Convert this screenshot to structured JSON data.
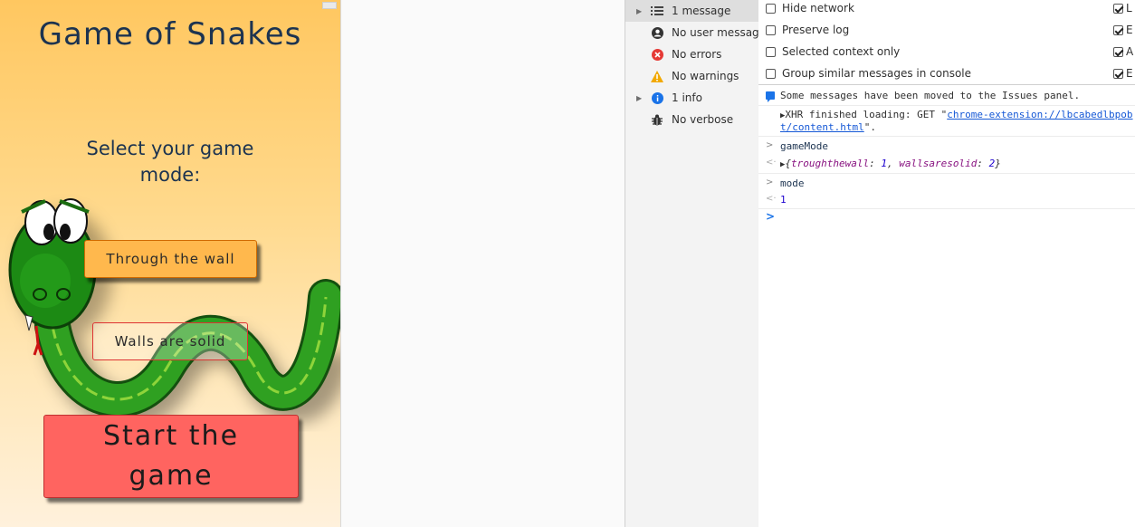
{
  "game": {
    "title": "Game of Snakes",
    "subtitle": "Select your game mode:",
    "buttons": {
      "through_wall": "Through the wall",
      "walls_solid": "Walls are solid",
      "start": "Start the game"
    },
    "colors": {
      "background": "#ffc760",
      "through_button": "#ffb84d",
      "start_button": "#ff6460"
    }
  },
  "devtools": {
    "sidebar": {
      "items": [
        {
          "icon": "list-icon",
          "label": "1 message",
          "expandable": true,
          "selected": true
        },
        {
          "icon": "user-icon",
          "label": "No user messag…",
          "expandable": false
        },
        {
          "icon": "error-icon",
          "label": "No errors",
          "expandable": false
        },
        {
          "icon": "warning-icon",
          "label": "No warnings",
          "expandable": false
        },
        {
          "icon": "info-icon",
          "label": "1 info",
          "expandable": true
        },
        {
          "icon": "bug-icon",
          "label": "No verbose",
          "expandable": false
        }
      ]
    },
    "settings": {
      "left": [
        {
          "label": "Hide network",
          "checked": false
        },
        {
          "label": "Preserve log",
          "checked": false
        },
        {
          "label": "Selected context only",
          "checked": false
        },
        {
          "label": "Group similar messages in console",
          "checked": false
        }
      ],
      "right": [
        {
          "label": "L",
          "checked": true
        },
        {
          "label": "E",
          "checked": true
        },
        {
          "label": "A",
          "checked": true
        },
        {
          "label": "E",
          "checked": true
        }
      ]
    },
    "console": {
      "issues_message": "Some messages have been moved to the Issues panel.",
      "xhr": {
        "prefix": "XHR finished loading: GET \"",
        "url_part1": "chrome-extension://lbcabedlbpob",
        "url_part2": "t/content.html",
        "suffix": "\"."
      },
      "entries": [
        {
          "input": "gameMode",
          "result_open": "{",
          "result_key1": "troughthewall",
          "result_val1": "1",
          "result_key2": "wallsaresolid",
          "result_val2": "2",
          "result_close": "}"
        },
        {
          "input": "mode",
          "result": "1"
        }
      ]
    }
  }
}
